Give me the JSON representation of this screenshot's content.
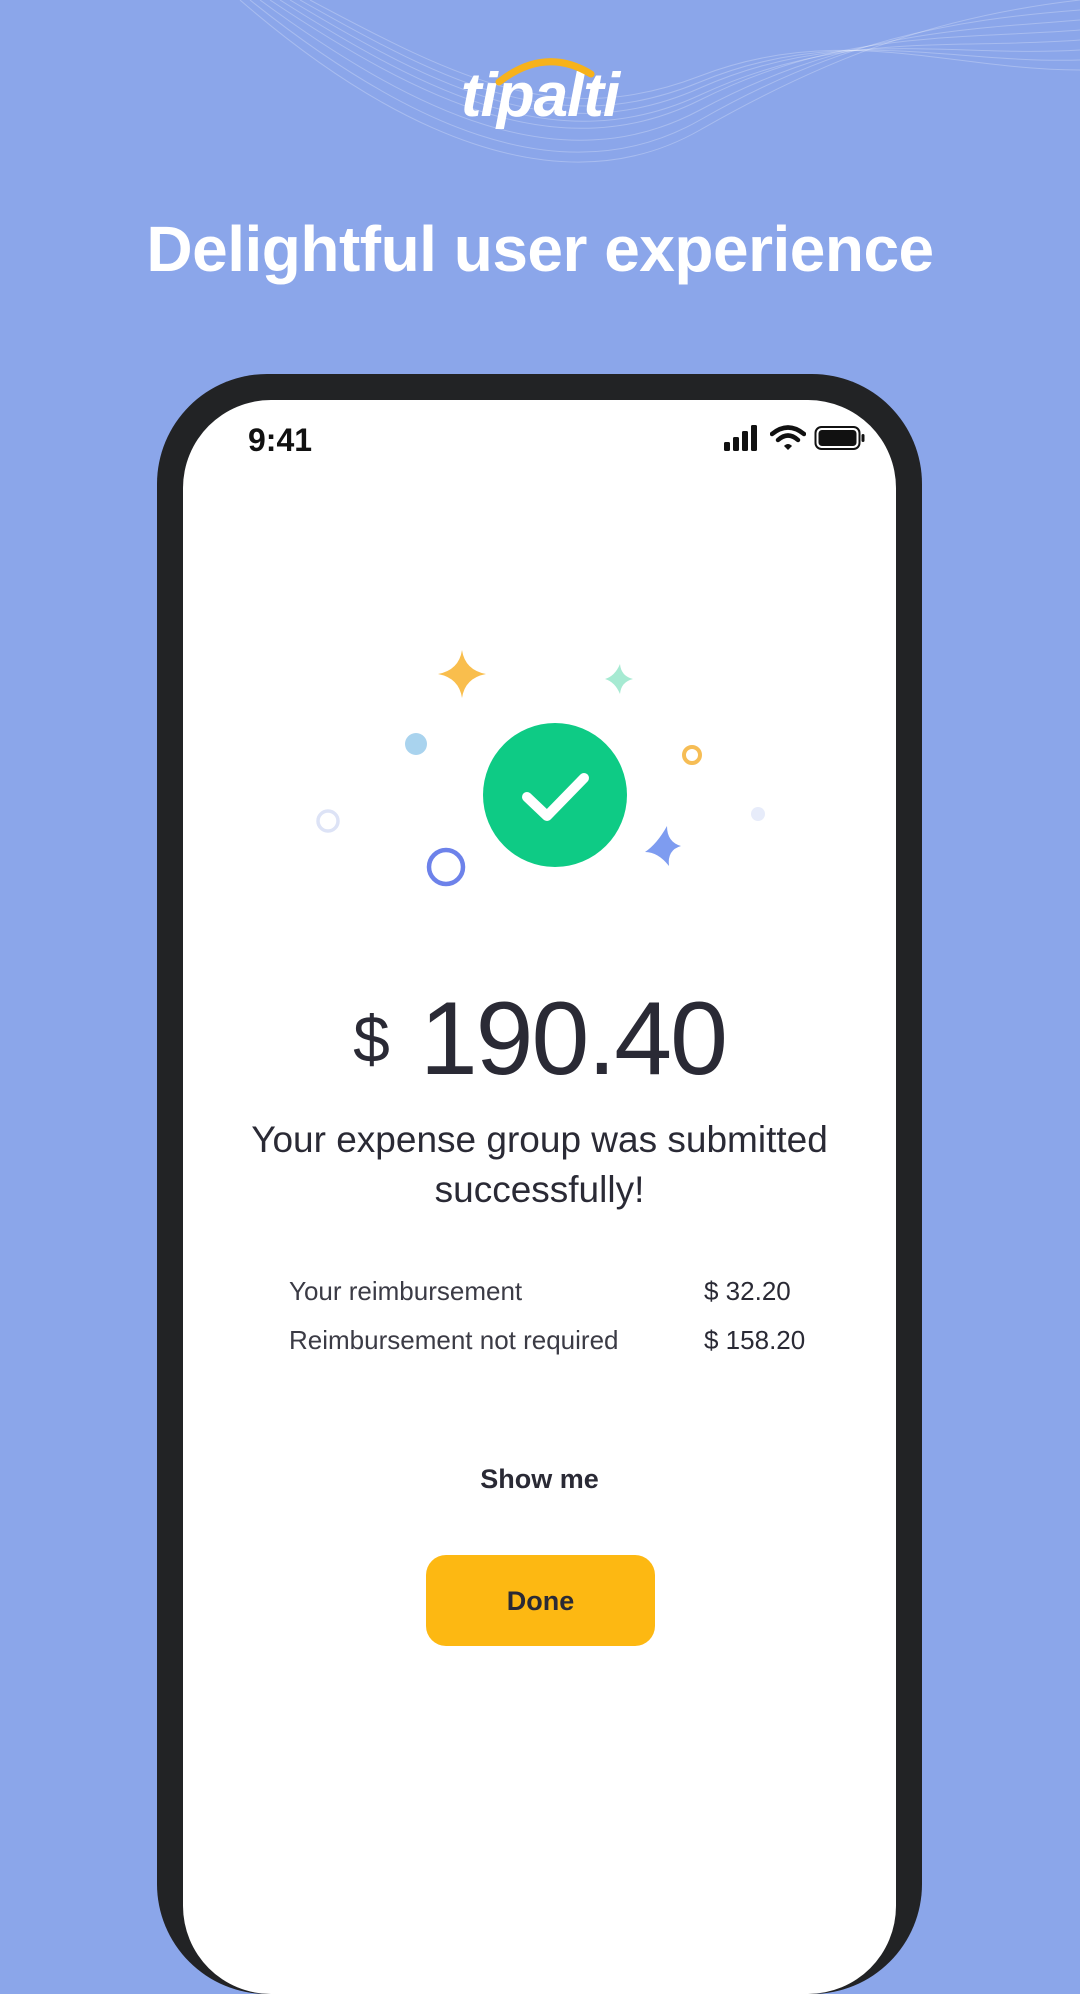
{
  "brand": {
    "logo_text": "tipalti",
    "arc_color": "#f7b21b"
  },
  "headline": "Delightful user experience",
  "status_bar": {
    "time": "9:41"
  },
  "confirmation": {
    "currency": "$",
    "amount": "190.40",
    "message": "Your expense group was submitted successfully!",
    "rows": [
      {
        "label": "Your reimbursement",
        "value": "$ 32.20"
      },
      {
        "label": "Reimbursement not required",
        "value": "$ 158.20"
      }
    ],
    "show_me_label": "Show me",
    "done_label": "Done"
  },
  "colors": {
    "background": "#8ba6ea",
    "success": "#0ecb85",
    "primary_button": "#fdb812",
    "phone_frame": "#222325"
  },
  "icons": [
    "signal-icon",
    "wifi-icon",
    "battery-icon",
    "checkmark-icon",
    "sparkle-icon"
  ]
}
